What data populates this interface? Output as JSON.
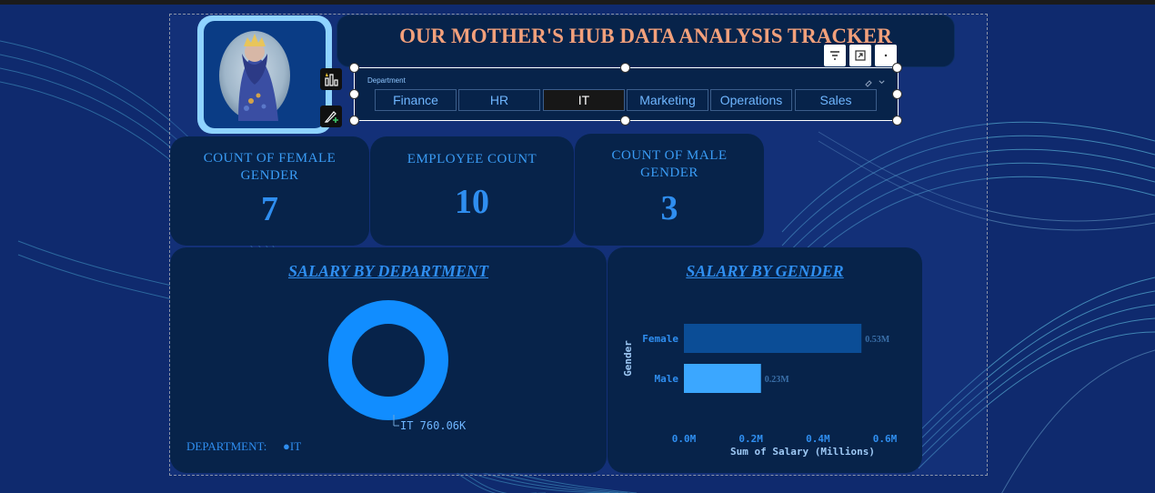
{
  "header": {
    "title": "OUR MOTHER'S HUB DATA ANALYSIS TRACKER"
  },
  "slicer": {
    "title": "Department",
    "options": [
      "Finance",
      "HR",
      "IT",
      "Marketing",
      "Operations",
      "Sales"
    ],
    "selected": "IT"
  },
  "kpis": {
    "female": {
      "label_line1": "COUNT OF FEMALE",
      "label_line2": "GENDER",
      "value": "7"
    },
    "employees": {
      "label": "EMPLOYEE COUNT",
      "value": "10"
    },
    "male": {
      "label_line1": "COUNT OF MALE",
      "label_line2": "GENDER",
      "value": "3"
    }
  },
  "chart_data": [
    {
      "type": "pie",
      "title": "SALARY BY DEPARTMENT",
      "categories": [
        "IT"
      ],
      "values": [
        760060
      ],
      "data_label": "IT 760.06K",
      "legend": {
        "title": "DEPARTMENT:",
        "items": [
          "IT"
        ],
        "placement": "bottom-left"
      },
      "colors": [
        "#118dff"
      ]
    },
    {
      "type": "bar",
      "orientation": "horizontal",
      "title": "SALARY BY GENDER",
      "categories": [
        "Female",
        "Male"
      ],
      "values": [
        0.53,
        0.23
      ],
      "data_labels": [
        "0.53M",
        "0.23M"
      ],
      "xlabel": "Sum of Salary (Millions)",
      "ylabel": "Gender",
      "xlim": [
        0,
        0.6
      ],
      "x_ticks": [
        "0.0M",
        "0.2M",
        "0.4M",
        "0.6M"
      ],
      "colors": [
        "#0b4d96",
        "#3ba7ff"
      ]
    }
  ],
  "colors": {
    "accent": "#2f8ef0",
    "card_bg": "#07234a",
    "title": "#f2a07b",
    "page_bg": "#0f2a6e"
  },
  "icons": [
    "filter-icon",
    "focus-mode-icon",
    "more-options-icon",
    "visual-build-icon",
    "format-visual-icon",
    "eraser-icon",
    "chevron-down-icon"
  ]
}
